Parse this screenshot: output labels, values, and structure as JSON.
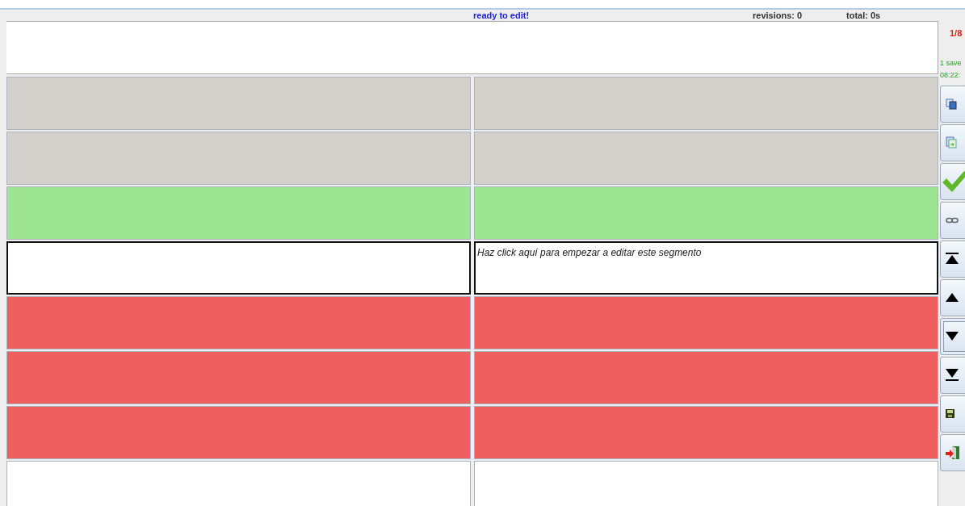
{
  "status_bar": {
    "message": "ready to edit!",
    "revisions": "revisions: 0",
    "total": "total: 0s"
  },
  "side": {
    "position": "1/8",
    "saved": "1 save",
    "time": "08:22:"
  },
  "segments": [
    {
      "kind": "context",
      "selected": false
    },
    {
      "kind": "context",
      "selected": false
    },
    {
      "kind": "approved",
      "selected": false
    },
    {
      "kind": "current",
      "selected": true,
      "hint": "Haz click aquí para empezar a editar este segmento"
    },
    {
      "kind": "rejected",
      "selected": false
    },
    {
      "kind": "rejected",
      "selected": false
    },
    {
      "kind": "rejected",
      "selected": false
    },
    {
      "kind": "empty",
      "selected": false
    }
  ],
  "toolbar": [
    {
      "kind": "copy",
      "focused": false
    },
    {
      "kind": "paste",
      "focused": false
    },
    {
      "kind": "approve",
      "focused": false
    },
    {
      "kind": "link",
      "focused": false
    },
    {
      "kind": "first",
      "focused": false
    },
    {
      "kind": "prev",
      "focused": false
    },
    {
      "kind": "next",
      "focused": true
    },
    {
      "kind": "last",
      "focused": false
    },
    {
      "kind": "save",
      "focused": false
    },
    {
      "kind": "exit",
      "focused": false
    }
  ]
}
